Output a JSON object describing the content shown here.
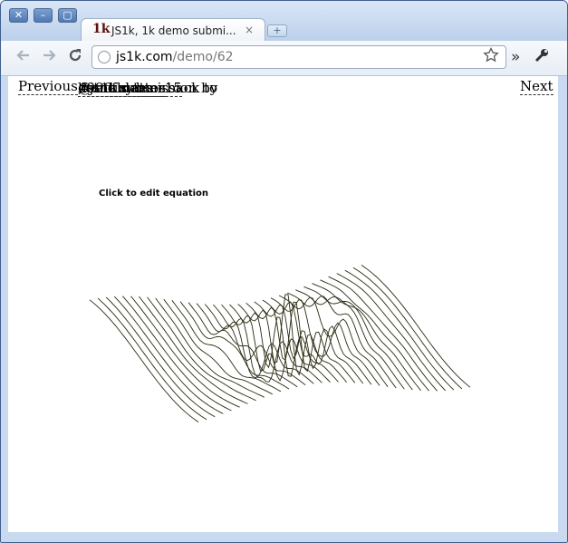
{
  "browser": {
    "tab": {
      "favicon_text": "1k",
      "title": "JS1k, 1k demo submi...",
      "close_glyph": "×"
    },
    "new_tab_glyph": "+",
    "window_buttons": {
      "close": "✕",
      "minimize": "–",
      "maximize": "▢"
    },
    "nav_icons": {
      "back": "back-arrow-icon",
      "forward": "forward-arrow-icon",
      "reload": "reload-icon",
      "bookmark": "star-icon",
      "more": "chevron-right-double-icon",
      "settings": "wrench-icon"
    },
    "address": {
      "host": "js1k.com",
      "path": "/demo/62"
    }
  },
  "page": {
    "nav": {
      "previous": "Previous",
      "tag": "#js1k",
      "text1": " demo submission by ",
      "author": "@antimatter15",
      "text2": ", 990 bytes - back to ",
      "list_link": "list of demos",
      "next": "Next"
    },
    "edit_hint": "Click to edit equation",
    "demo": {
      "type": "3d-wave-surface",
      "line_color": "#2a2a10"
    }
  }
}
